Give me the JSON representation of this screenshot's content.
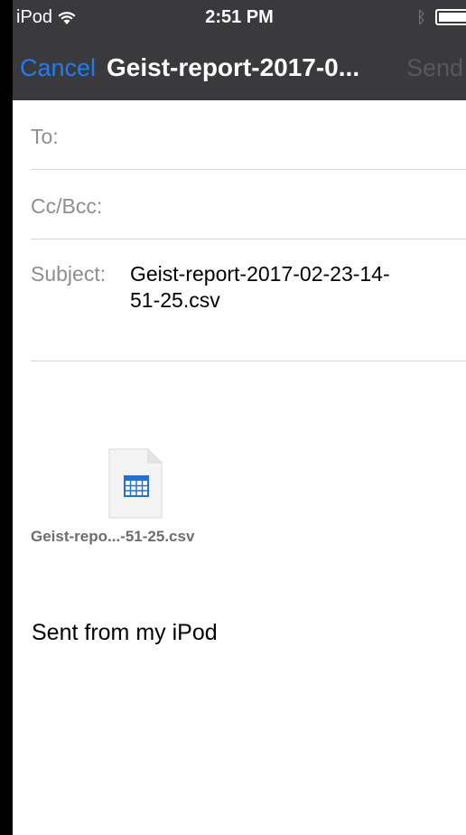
{
  "status_bar": {
    "carrier": "iPod",
    "time": "2:51 PM",
    "icons": [
      "wifi-icon",
      "bluetooth-icon",
      "battery-icon"
    ]
  },
  "nav": {
    "cancel_label": "Cancel",
    "title": "Geist-report-2017-0...",
    "send_label": "Send"
  },
  "fields": {
    "to_label": "To:",
    "to_value": "",
    "cc_label": "Cc/Bcc:",
    "cc_value": "",
    "subject_label": "Subject:",
    "subject_value": "Geist-report-2017-02-23-14-51-25.csv"
  },
  "attachment": {
    "name": "Geist-repo...-51-25.csv",
    "icon": "spreadsheet-file-icon"
  },
  "body": {
    "signature": "Sent from my iPod"
  },
  "colors": {
    "accent": "#1e7cf5",
    "nav_background": "#3a3a3c",
    "label_gray": "#8e8e93",
    "disabled_send": "#58585c"
  }
}
